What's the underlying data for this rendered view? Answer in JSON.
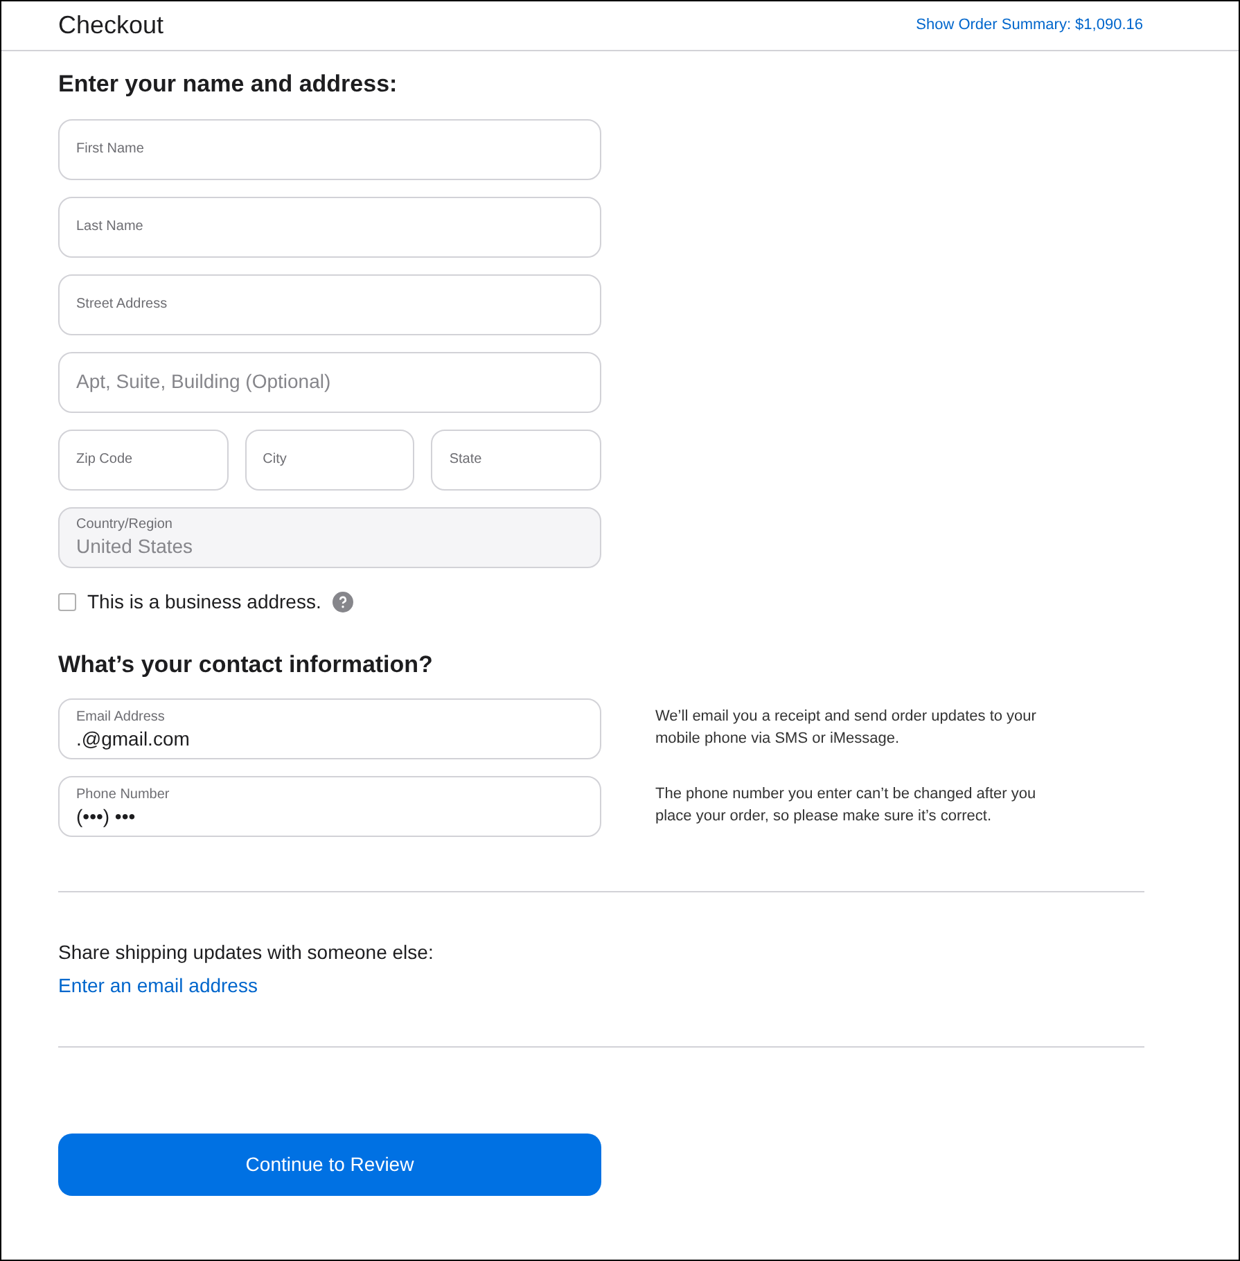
{
  "header": {
    "title": "Checkout",
    "summary_link": "Show Order Summary: $1,090.16"
  },
  "address": {
    "heading": "Enter your name and address:",
    "rows": [
      [
        {
          "label": "First Name"
        }
      ],
      [
        {
          "label": "Last Name"
        }
      ],
      [
        {
          "label": "Street Address"
        }
      ],
      [
        {
          "placeholder": "Apt, Suite, Building (Optional)"
        }
      ],
      [
        {
          "label": "Zip Code"
        },
        {
          "label": "City"
        },
        {
          "label": "State"
        }
      ],
      [
        {
          "label": "Country/Region",
          "value": "United States",
          "disabled": true
        }
      ]
    ],
    "business": {
      "label": "This is a business address.",
      "checked": false
    }
  },
  "contact": {
    "heading": "What’s your contact information?",
    "fields": [
      {
        "label": "Email Address",
        "value": ".@gmail.com",
        "note": "We’ll email you a receipt and send order updates to your mobile phone via SMS or iMessage."
      },
      {
        "label": "Phone Number",
        "value": "(•••) •••",
        "note": "The phone number you enter can’t be changed after you place your order, so please make sure it’s correct."
      }
    ]
  },
  "share": {
    "text": "Share shipping updates with someone else:",
    "link": "Enter an email address"
  },
  "continue_button": "Continue to Review"
}
